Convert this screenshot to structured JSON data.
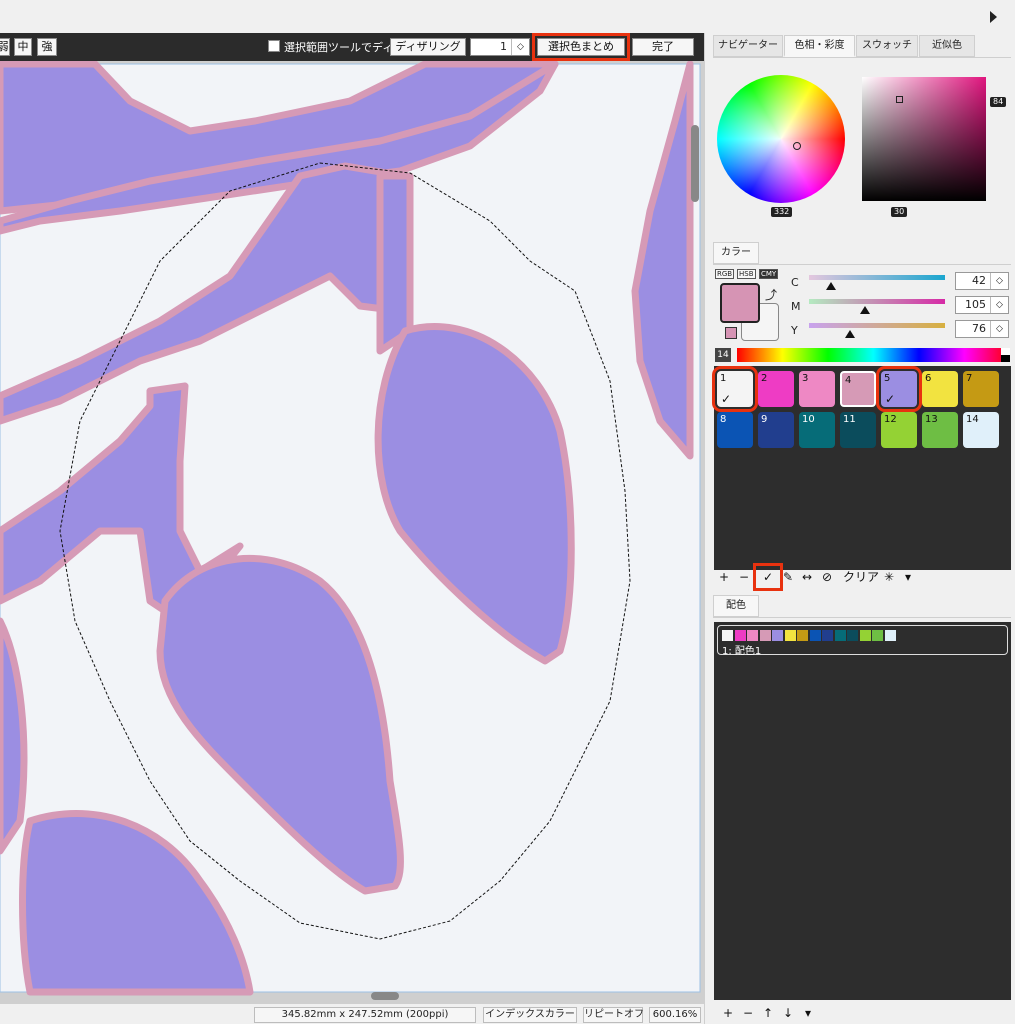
{
  "toolbar": {
    "mode_buttons": [
      "弱",
      "中",
      "強"
    ],
    "checkbox_label": "選択範囲ツールでディザ",
    "dithering_label": "ディザリング",
    "dither_value": "1",
    "merge_button": "選択色まとめ",
    "done_button": "完了"
  },
  "status": {
    "size": "345.82mm x 247.52mm (200ppi)",
    "color_mode": "インデックスカラー",
    "repeat": "リピートオフ",
    "zoom": "600.16%"
  },
  "panel": {
    "tabs": [
      "ナビゲーター",
      "色相・彩度",
      "スウォッチ",
      "近似色"
    ],
    "active_tab": "色相・彩度",
    "hue_value": "332",
    "sat_value": "30",
    "bright_value": "84",
    "color_tab": "カラー",
    "modes": [
      "RGB",
      "HSB",
      "CMY"
    ],
    "active_mode": "CMY",
    "sliders": [
      {
        "label": "C",
        "value": "42",
        "level": 0.16
      },
      {
        "label": "M",
        "value": "105",
        "level": 0.41
      },
      {
        "label": "Y",
        "value": "76",
        "level": 0.3
      }
    ],
    "palette_count": "14",
    "tools": {
      "clear": "クリア"
    },
    "scheme_tab": "配色",
    "scheme_label": "1: 配色1"
  },
  "palette": [
    {
      "n": "1",
      "color": "#f4f4f4",
      "checked": true
    },
    {
      "n": "2",
      "color": "#ee3cc4",
      "checked": false
    },
    {
      "n": "3",
      "color": "#ee88c4",
      "checked": false
    },
    {
      "n": "4",
      "color": "#d69ab6",
      "checked": false
    },
    {
      "n": "5",
      "color": "#9b8ee2",
      "checked": true
    },
    {
      "n": "6",
      "color": "#f2e340",
      "checked": false
    },
    {
      "n": "7",
      "color": "#c59a14",
      "checked": false
    },
    {
      "n": "8",
      "color": "#0b54b4",
      "checked": false
    },
    {
      "n": "9",
      "color": "#213e8e",
      "checked": false
    },
    {
      "n": "10",
      "color": "#066c78",
      "checked": false
    },
    {
      "n": "11",
      "color": "#0b4c5c",
      "checked": false
    },
    {
      "n": "12",
      "color": "#94d234",
      "checked": false
    },
    {
      "n": "13",
      "color": "#6ebe44",
      "checked": false
    },
    {
      "n": "14",
      "color": "#e0f0fa",
      "checked": false
    }
  ],
  "colors": {
    "leaf": "#9b8ee2",
    "outline": "#d69ab6",
    "background": "#f2f4f8",
    "highlight": "#e8320f"
  }
}
